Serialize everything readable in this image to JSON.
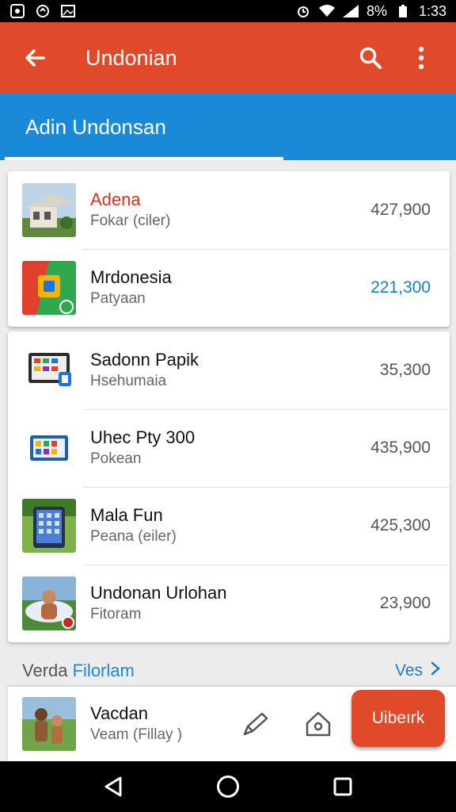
{
  "status_bar": {
    "time": "1:33",
    "battery": "8%",
    "icons": [
      "whatsapp-icon",
      "sync-icon",
      "image-icon",
      "alarm-icon",
      "wifi-icon",
      "signal-icon",
      "battery-icon"
    ]
  },
  "app_bar": {
    "title": "Undonian",
    "back_icon": "arrow-left-icon",
    "search_icon": "search-icon",
    "menu_icon": "more-vert-icon",
    "color": "#e04a2a"
  },
  "tabs": [
    {
      "label": "Adin Undonsan",
      "active": true
    }
  ],
  "card_one": {
    "items": [
      {
        "title": "Adena",
        "subtitle": "Fokar (ciler)",
        "price": "427,900",
        "thumb": "building-photo"
      },
      {
        "title": "Mrdonesia",
        "subtitle": "Patyaan",
        "price": "221,300",
        "thumb": "app-logo"
      }
    ]
  },
  "card_two": {
    "items": [
      {
        "title": "Sadonn Papik",
        "subtitle": "Hsehumaia",
        "price": "35,300",
        "thumb": "tablet-apps"
      },
      {
        "title": "Uhec Pty 300",
        "subtitle": "Pokean",
        "price": "435,900",
        "thumb": "tablet-blue"
      },
      {
        "title": "Mala Fun",
        "subtitle": "Peana (eiler)",
        "price": "425,300",
        "thumb": "tablet-grass"
      },
      {
        "title": "Undonan Urlohan",
        "subtitle": "Fitoram",
        "price": "23,900",
        "thumb": "person-photo"
      }
    ]
  },
  "section": {
    "title_prefix": "Verda ",
    "title_accent": "Filorlam",
    "link": "Ves"
  },
  "bottom_item": {
    "title": "Vacdan",
    "subtitle": "Veam (Fillay )",
    "action_button": "Uibeırk",
    "icons": [
      "pen-icon",
      "house-icon"
    ]
  },
  "colors": {
    "primary": "#e04a2a",
    "accent": "#1a8ad8",
    "price_highlight": "#1a7fc4",
    "title_highlight": "#d8321e"
  }
}
